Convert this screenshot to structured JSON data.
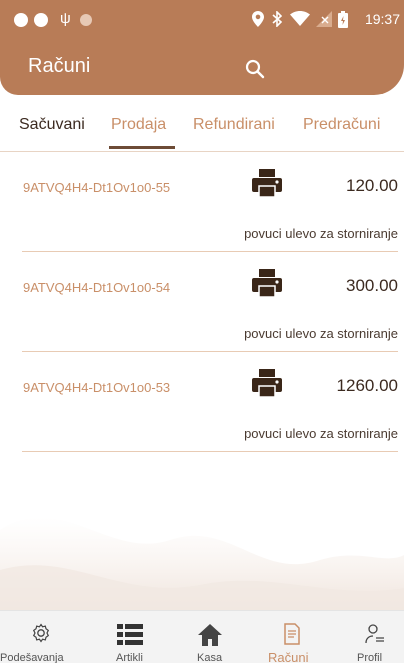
{
  "status_bar": {
    "time": "19:37"
  },
  "app": {
    "title": "Računi"
  },
  "tabs": [
    {
      "label": "Sačuvani"
    },
    {
      "label": "Prodaja"
    },
    {
      "label": "Refundirani"
    },
    {
      "label": "Predračuni"
    }
  ],
  "receipts": [
    {
      "code": "9ATVQ4H4-Dt1Ov1o0-55",
      "amount": "120.00",
      "hint": "povuci ulevo za storniranje"
    },
    {
      "code": "9ATVQ4H4-Dt1Ov1o0-54",
      "amount": "300.00",
      "hint": "povuci ulevo za storniranje"
    },
    {
      "code": "9ATVQ4H4-Dt1Ov1o0-53",
      "amount": "1260.00",
      "hint": "povuci ulevo za storniranje"
    }
  ],
  "bottom_nav": [
    {
      "label": "Podešavanja",
      "icon": "gear-icon"
    },
    {
      "label": "Artikli",
      "icon": "list-icon"
    },
    {
      "label": "Kasa",
      "icon": "home-icon"
    },
    {
      "label": "Računi",
      "icon": "receipt-icon"
    },
    {
      "label": "Profil",
      "icon": "profile-icon"
    }
  ],
  "colors": {
    "header": "#b87c57",
    "accent": "#c98f68",
    "printer": "#3a2618"
  }
}
